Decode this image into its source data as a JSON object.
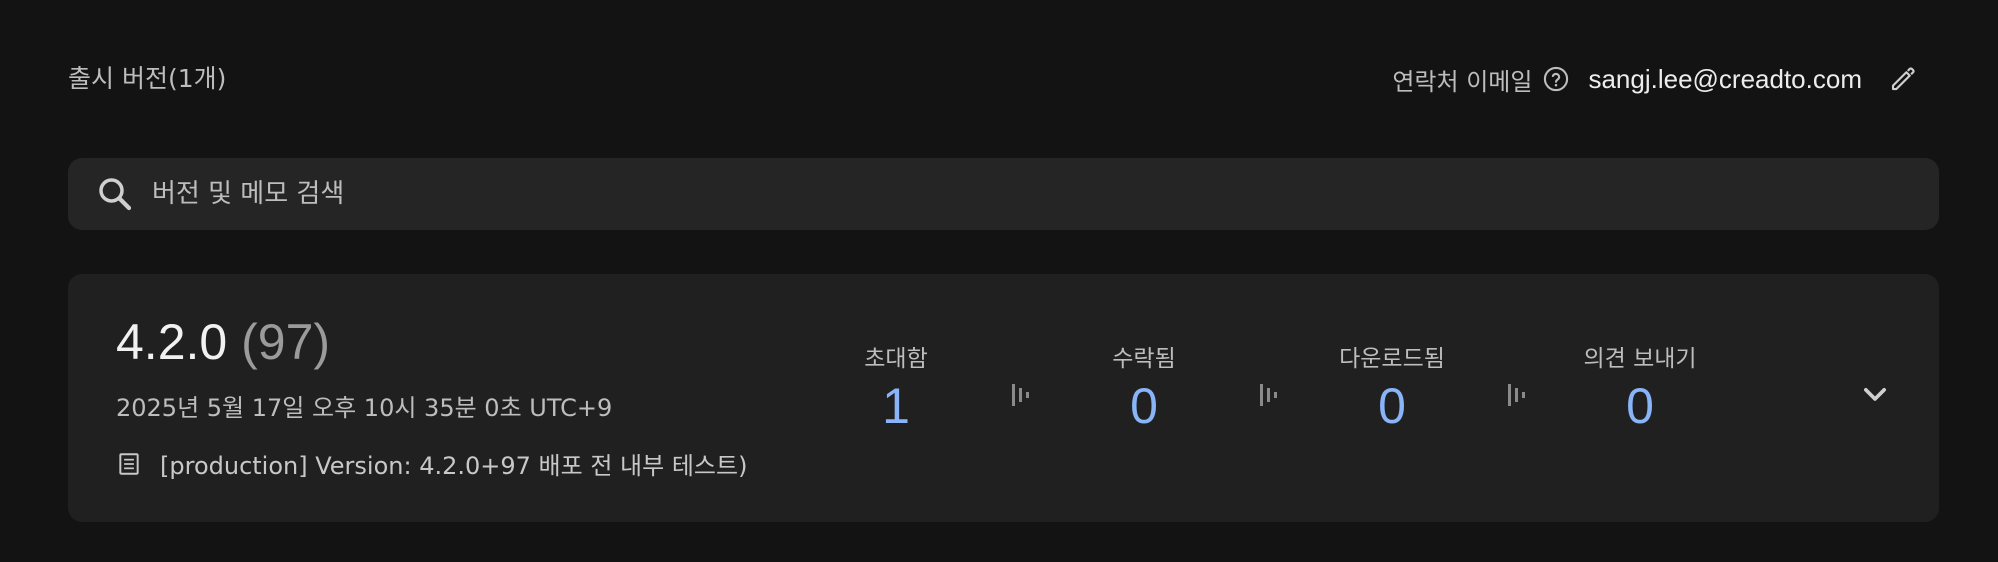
{
  "header": {
    "title": "출시 버전(1개)",
    "contact_label": "연락처 이메일",
    "help_icon": "help-circle-icon",
    "contact_email": "sangj.lee@creadto.com",
    "edit_icon": "pencil-icon"
  },
  "search": {
    "icon": "search-icon",
    "placeholder": "버전 및 메모 검색",
    "value": ""
  },
  "release": {
    "version": "4.2.0",
    "build": "(97)",
    "date": "2025년 5월 17일 오후 10시 35분 0초 UTC+9",
    "note_icon": "notes-icon",
    "note": "[production] Version: 4.2.0+97 배포 전 내부 테스트)",
    "stats": [
      {
        "label": "초대함",
        "value": "1"
      },
      {
        "label": "수락됨",
        "value": "0"
      },
      {
        "label": "다운로드됨",
        "value": "0"
      },
      {
        "label": "의견 보내기",
        "value": "0"
      }
    ],
    "separator_icon": "funnel-step-icon",
    "expand_icon": "chevron-down-icon"
  },
  "colors": {
    "background": "#131313",
    "card": "#202020",
    "search": "#252525",
    "accent": "#8ab4f8",
    "muted_text": "#bdbdbd"
  }
}
